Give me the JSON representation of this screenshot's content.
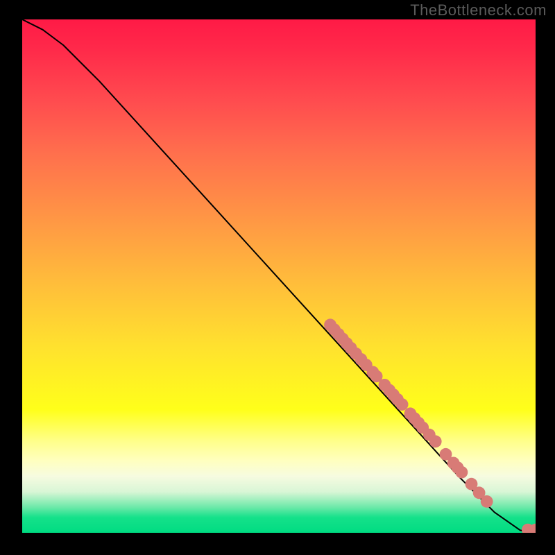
{
  "watermark": "TheBottleneck.com",
  "gradient": {
    "top": "#ff1a46",
    "mid_upper": "#ff9a44",
    "mid": "#ffff1a",
    "lower_band": "#ffffc0",
    "bottom": "#00dc82"
  },
  "chart_data": {
    "type": "line",
    "title": "",
    "xlabel": "",
    "ylabel": "",
    "xlim": [
      0,
      100
    ],
    "ylim": [
      0,
      100
    ],
    "series": [
      {
        "name": "curve",
        "x": [
          0,
          4,
          8,
          15,
          25,
          35,
          45,
          55,
          65,
          75,
          85,
          92,
          97,
          98.5,
          100
        ],
        "y": [
          100,
          98,
          95,
          88,
          77,
          66,
          55,
          44,
          33,
          22,
          11,
          4,
          0.5,
          0.2,
          0.4
        ],
        "stroke": "#000000"
      }
    ],
    "points": {
      "name": "markers",
      "color": "#d87b76",
      "radius": 1.2,
      "xy": [
        [
          60.0,
          40.5
        ],
        [
          60.8,
          39.6
        ],
        [
          61.6,
          38.7
        ],
        [
          62.4,
          37.8
        ],
        [
          63.2,
          36.9
        ],
        [
          64.0,
          36.0
        ],
        [
          65.0,
          34.9
        ],
        [
          66.0,
          33.8
        ],
        [
          67.0,
          32.7
        ],
        [
          68.3,
          31.3
        ],
        [
          69.0,
          30.5
        ],
        [
          70.6,
          28.8
        ],
        [
          71.5,
          27.8
        ],
        [
          72.3,
          26.9
        ],
        [
          73.1,
          26.0
        ],
        [
          74.0,
          25.0
        ],
        [
          75.6,
          23.2
        ],
        [
          76.4,
          22.3
        ],
        [
          77.2,
          21.4
        ],
        [
          78.0,
          20.5
        ],
        [
          79.3,
          19.1
        ],
        [
          80.5,
          17.8
        ],
        [
          82.5,
          15.3
        ],
        [
          84.0,
          13.6
        ],
        [
          84.8,
          12.7
        ],
        [
          85.6,
          11.8
        ],
        [
          87.5,
          9.5
        ],
        [
          89.0,
          7.8
        ],
        [
          90.5,
          6.1
        ],
        [
          98.5,
          0.6
        ],
        [
          100.0,
          0.6
        ]
      ]
    }
  }
}
